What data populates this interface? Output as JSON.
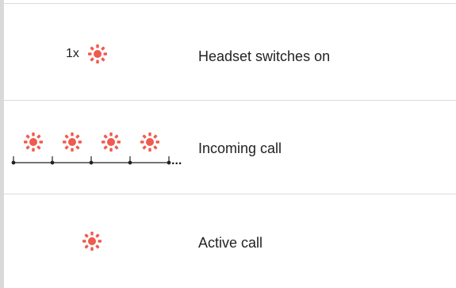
{
  "rows": [
    {
      "count_label": "1x",
      "description": "Headset switches on"
    },
    {
      "description": "Incoming call",
      "timeline_suffix": "..."
    },
    {
      "description": "Active call"
    }
  ],
  "colors": {
    "led": "#ef5a4f",
    "rule": "#dcdcdc",
    "left_bar": "#d9d9d9"
  },
  "icons": [
    "flash-led-icon"
  ]
}
